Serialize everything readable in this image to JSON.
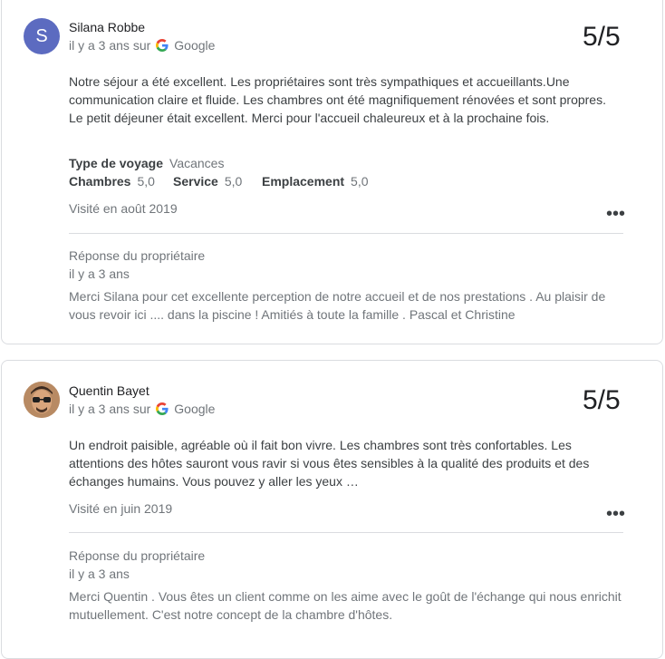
{
  "reviews": [
    {
      "avatar_letter": "S",
      "reviewer": "Silana Robbe",
      "time": "il y a 3 ans sur",
      "source": "Google",
      "score": "5/5",
      "text": "Notre séjour a été excellent. Les propriétaires sont très sympathiques et accueillants.Une communication claire et fluide. Les chambres ont été magnifiquement rénovées et sont propres. Le petit déjeuner était excellent. Merci pour l'accueil chaleureux et à la prochaine fois.",
      "trip_type_label": "Type de voyage",
      "trip_type_value": "Vacances",
      "ratings": [
        {
          "label": "Chambres",
          "value": "5,0"
        },
        {
          "label": "Service",
          "value": "5,0"
        },
        {
          "label": "Emplacement",
          "value": "5,0"
        }
      ],
      "visited": "Visité en août 2019",
      "owner_response_label": "Réponse du propriétaire",
      "owner_response_time": "il y a 3 ans",
      "owner_response_text": "Merci Silana pour cet excellente perception de notre accueil et de nos prestations . Au plaisir de vous revoir ici .... dans la piscine ! Amitiés à toute la famille . Pascal et Christine"
    },
    {
      "reviewer": "Quentin Bayet",
      "time": "il y a 3 ans sur",
      "source": "Google",
      "score": "5/5",
      "text": "Un endroit paisible, agréable où il fait bon vivre. Les chambres sont très confortables. Les attentions des hôtes sauront vous ravir si vous êtes sensibles à la qualité des produits et des échanges humains. Vous pouvez y aller les yeux …",
      "visited": "Visité en juin 2019",
      "owner_response_label": "Réponse du propriétaire",
      "owner_response_time": "il y a 3 ans",
      "owner_response_text": "Merci Quentin . Vous êtes un client comme on les aime avec le goût de l'échange qui nous enrichit mutuellement. C'est notre concept de la chambre d'hôtes."
    }
  ],
  "more_icon": "more-horizontal-icon",
  "colors": {
    "avatar": "#5c6bc0",
    "border": "#dadce0",
    "muted": "#70757a"
  }
}
